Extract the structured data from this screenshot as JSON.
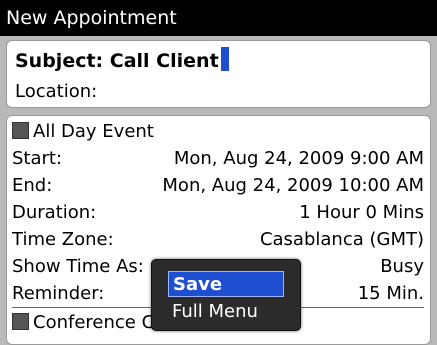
{
  "window": {
    "title": "New Appointment"
  },
  "subject": {
    "label": "Subject:",
    "value": "Call Client"
  },
  "location": {
    "label": "Location:"
  },
  "fields": {
    "all_day": "All Day Event",
    "start": {
      "label": "Start:",
      "value": "Mon, Aug 24, 2009 9:00 AM"
    },
    "end": {
      "label": "End:",
      "value": "Mon, Aug 24, 2009 10:00 AM"
    },
    "duration": {
      "label": "Duration:",
      "value": "1 Hour 0 Mins"
    },
    "timezone": {
      "label": "Time Zone:",
      "value": "Casablanca (GMT)"
    },
    "show_time_as": {
      "label": "Show Time As:",
      "value": "Busy"
    },
    "reminder": {
      "label": "Reminder:",
      "value": "15 Min."
    },
    "conference": "Conference Call"
  },
  "menu": {
    "items": [
      "Save",
      "Full Menu"
    ]
  },
  "colors": {
    "selection": "#1f4ed1",
    "titlebar": "#000000"
  }
}
